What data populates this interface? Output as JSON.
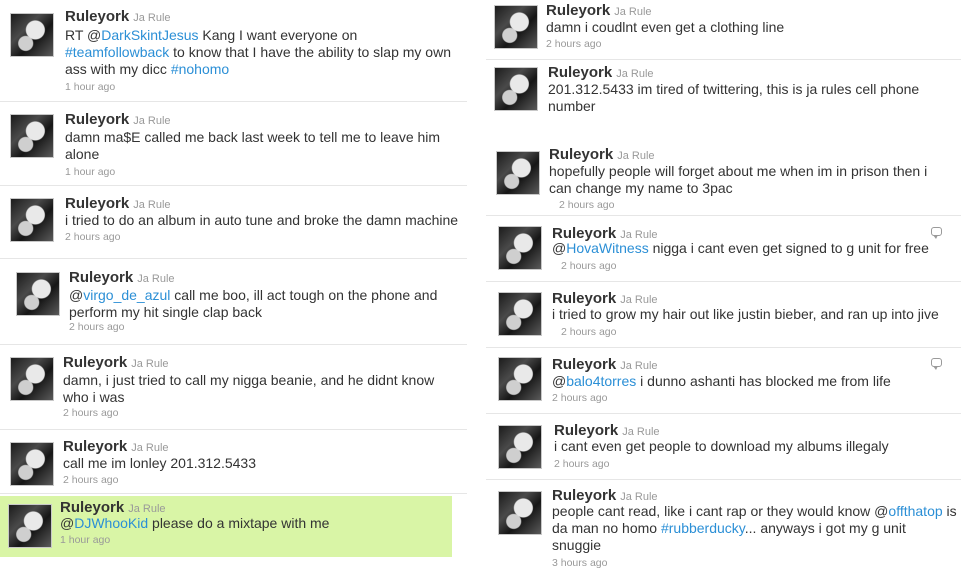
{
  "left_tweets": [
    {
      "username": "Ruleyork",
      "realname": "Ja Rule",
      "parts": [
        {
          "t": "RT @"
        },
        {
          "t": "DarkSkintJesus",
          "link": true
        },
        {
          "t": " Kang I want everyone on "
        },
        {
          "t": "#teamfollowback",
          "link": true
        },
        {
          "t": " to know that I have the ability to slap my own ass with my dicc "
        },
        {
          "t": "#nohomo",
          "link": true
        }
      ],
      "time": "1 hour ago"
    },
    {
      "username": "Ruleyork",
      "realname": "Ja Rule",
      "parts": [
        {
          "t": "damn ma$E called me back last week to tell me to leave him alone"
        }
      ],
      "time": "1 hour ago"
    },
    {
      "username": "Ruleyork",
      "realname": "Ja Rule",
      "parts": [
        {
          "t": "i tried to do an album in auto tune and broke the damn machine"
        }
      ],
      "time": "2 hours ago"
    },
    {
      "username": "Ruleyork",
      "realname": "Ja Rule",
      "parts": [
        {
          "t": "@"
        },
        {
          "t": "virgo_de_azul",
          "link": true
        },
        {
          "t": " call me boo, ill act tough on the phone and perform my hit single clap back"
        }
      ],
      "time": "2 hours ago"
    },
    {
      "username": "Ruleyork",
      "realname": "Ja Rule",
      "parts": [
        {
          "t": "damn, i just tried to call my nigga beanie, and he didnt know who i was"
        }
      ],
      "time": "2 hours ago"
    },
    {
      "username": "Ruleyork",
      "realname": "Ja Rule",
      "parts": [
        {
          "t": "call me im lonley 201.312.5433"
        }
      ],
      "time": "2 hours ago"
    },
    {
      "username": "Ruleyork",
      "realname": "Ja Rule",
      "parts": [
        {
          "t": "@"
        },
        {
          "t": "DJWhooKid",
          "link": true
        },
        {
          "t": " please do a mixtape with me"
        }
      ],
      "time": "1 hour ago"
    }
  ],
  "right_tweets": [
    {
      "username": "Ruleyork",
      "realname": "Ja Rule",
      "parts": [
        {
          "t": "damn i coudlnt even get a clothing line"
        }
      ],
      "time": "2 hours ago"
    },
    {
      "username": "Ruleyork",
      "realname": "Ja Rule",
      "parts": [
        {
          "t": "201.312.5433 im tired of twittering, this is ja rules cell phone number"
        }
      ],
      "time": ""
    },
    {
      "username": "Ruleyork",
      "realname": "Ja Rule",
      "parts": [
        {
          "t": "hopefully people will forget about me when im in prison then i can change my name to 3pac"
        }
      ],
      "time": "2 hours ago"
    },
    {
      "username": "Ruleyork",
      "realname": "Ja Rule",
      "parts": [
        {
          "t": "@"
        },
        {
          "t": "HovaWitness",
          "link": true
        },
        {
          "t": " nigga i cant even get signed to g unit for free"
        }
      ],
      "time": "2 hours ago"
    },
    {
      "username": "Ruleyork",
      "realname": "Ja Rule",
      "parts": [
        {
          "t": "i tried to grow my hair out like justin bieber, and ran up into jive"
        }
      ],
      "time": "2 hours ago"
    },
    {
      "username": "Ruleyork",
      "realname": "Ja Rule",
      "parts": [
        {
          "t": "@"
        },
        {
          "t": "balo4torres",
          "link": true
        },
        {
          "t": " i dunno ashanti has blocked me from life"
        }
      ],
      "time": "2 hours ago"
    },
    {
      "username": "Ruleyork",
      "realname": "Ja Rule",
      "parts": [
        {
          "t": "i cant even get people to download my albums illegaly"
        }
      ],
      "time": "2 hours ago"
    },
    {
      "username": "Ruleyork",
      "realname": "Ja Rule",
      "parts": [
        {
          "t": "people cant read, like i cant rap or they would know @"
        },
        {
          "t": "offthatop",
          "link": true
        },
        {
          "t": " is da man no homo "
        },
        {
          "t": "#rubberducky",
          "link": true
        },
        {
          "t": "... anyways i got my g unit snuggie"
        }
      ],
      "time": "3 hours ago"
    }
  ]
}
